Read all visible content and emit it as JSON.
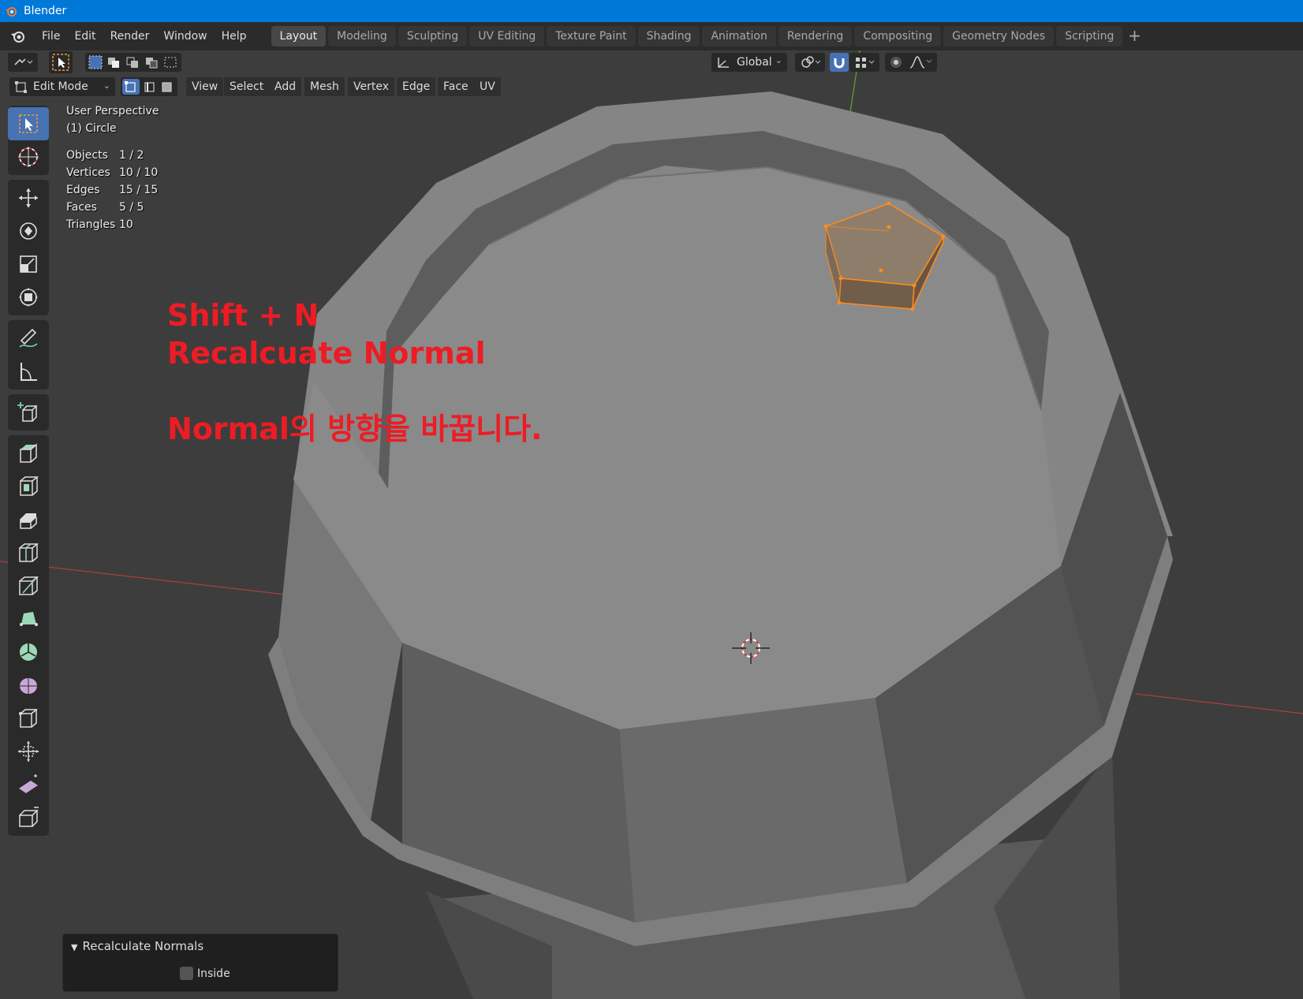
{
  "window": {
    "title": "Blender"
  },
  "menubar": {
    "items": [
      "File",
      "Edit",
      "Render",
      "Window",
      "Help"
    ]
  },
  "workspaces": {
    "tabs": [
      "Layout",
      "Modeling",
      "Sculpting",
      "UV Editing",
      "Texture Paint",
      "Shading",
      "Animation",
      "Rendering",
      "Compositing",
      "Geometry Nodes",
      "Scripting"
    ],
    "active": "Layout",
    "add_label": "+"
  },
  "header": {
    "mode": "Edit Mode",
    "menus": [
      "View",
      "Select",
      "Add",
      "Mesh",
      "Vertex",
      "Edge",
      "Face",
      "UV"
    ],
    "orientation": "Global"
  },
  "overlay": {
    "perspective": "User Perspective",
    "object": "(1) Circle",
    "stats": [
      {
        "label": "Objects",
        "value": "1 / 2"
      },
      {
        "label": "Vertices",
        "value": "10 / 10"
      },
      {
        "label": "Edges",
        "value": "15 / 15"
      },
      {
        "label": "Faces",
        "value": "5 / 5"
      },
      {
        "label": "Triangles",
        "value": "10"
      }
    ]
  },
  "annotation": {
    "line1": "Shift + N",
    "line2": "Recalcuate Normal",
    "line3": "Normal의 방향을 바꿉니다."
  },
  "operator_panel": {
    "title": "Recalculate Normals",
    "option_label": "Inside",
    "option_checked": false
  },
  "toolbar": {
    "tools": [
      "select-box",
      "cursor",
      "move",
      "rotate",
      "scale",
      "transform",
      "annotate",
      "measure",
      "add-cube",
      "extrude-region",
      "inset-faces",
      "bevel",
      "loop-cut",
      "knife",
      "poly-build",
      "spin",
      "smooth",
      "edge-slide",
      "shrink-fatten",
      "shear",
      "rip-region"
    ]
  },
  "colors": {
    "titlebar": "#0078d7",
    "accent": "#4772b3",
    "selection": "#ff8c1a",
    "annotation": "#ed1c24"
  }
}
